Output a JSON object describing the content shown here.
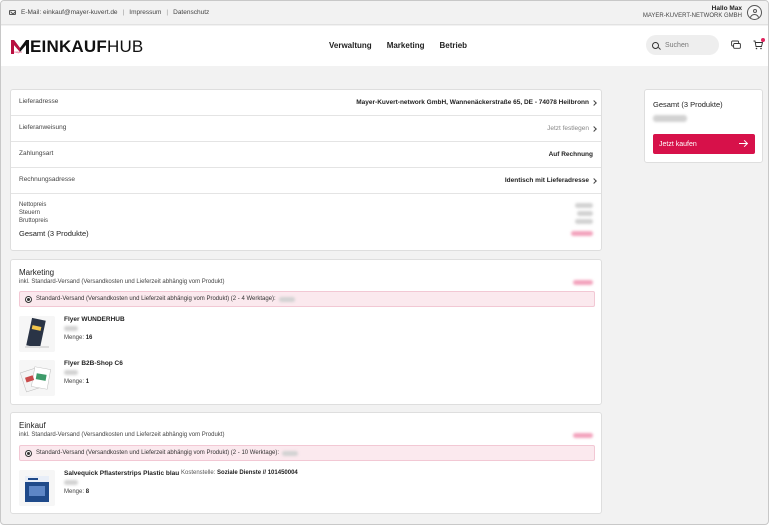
{
  "topbar": {
    "email": "E-Mail: einkauf@mayer-kuvert.de",
    "separator": "|",
    "impressum": "Impressum",
    "datenschutz": "Datenschutz",
    "greeting": "Hallo Max",
    "company": "MAYER-KUVERT-NETWORK GMBH"
  },
  "header": {
    "logo_main": "EINKAUF",
    "logo_hub": "HUB",
    "logo_mark_text": "mayer",
    "nav": [
      "Verwaltung",
      "Marketing",
      "Betrieb"
    ],
    "search_placeholder": "Suchen"
  },
  "checkout": {
    "rows": [
      {
        "label": "Lieferadresse",
        "value": "Mayer-Kuvert-network GmbH, Wannenäckerstraße 65, DE - 74078 Heilbronn"
      },
      {
        "label": "Lieferanweisung",
        "value": "Jetzt festlegen"
      },
      {
        "label": "Zahlungsart",
        "value": "Auf Rechnung"
      },
      {
        "label": "Rechnungsadresse",
        "value": "Identisch mit Lieferadresse"
      }
    ],
    "totals": {
      "netto": "Nettopreis",
      "steuern": "Steuern",
      "brutto": "Bruttopreis",
      "gesamt": "Gesamt (3 Produkte)"
    }
  },
  "sections": [
    {
      "title": "Marketing",
      "subtitle": "inkl. Standard-Versand (Versandkosten und Lieferzeit abhängig vom Produkt)",
      "shipping": "Standard-Versand (Versandkosten und Lieferzeit abhängig vom Produkt) (2 - 4 Werktage):",
      "products": [
        {
          "name": "Flyer WUNDERHUB",
          "qty_label": "Menge:",
          "qty": "16"
        },
        {
          "name": "Flyer B2B-Shop C6",
          "qty_label": "Menge:",
          "qty": "1"
        }
      ]
    },
    {
      "title": "Einkauf",
      "subtitle": "inkl. Standard-Versand (Versandkosten und Lieferzeit abhängig vom Produkt)",
      "shipping": "Standard-Versand (Versandkosten und Lieferzeit abhängig vom Produkt) (2 - 10 Werktage):",
      "products": [
        {
          "name": "Salvequick Pflasterstrips Plastic blau",
          "qty_label": "Menge:",
          "qty": "8",
          "cost_center_label": "Kostenstelle:",
          "cost_center": "Soziale Dienste // 101450004"
        }
      ]
    }
  ],
  "summary": {
    "title": "Gesamt (3 Produkte)",
    "button": "Jetzt kaufen"
  },
  "colors": {
    "accent": "#d7114a",
    "shipping_bg": "#fbe9ee"
  }
}
